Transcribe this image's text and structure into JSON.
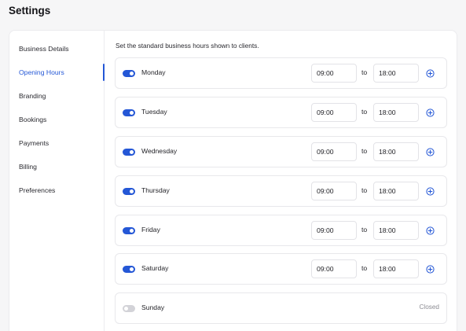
{
  "page": {
    "title": "Settings"
  },
  "sidebar": {
    "items": [
      {
        "label": "Business Details",
        "active": false
      },
      {
        "label": "Opening Hours",
        "active": true
      },
      {
        "label": "Branding",
        "active": false
      },
      {
        "label": "Bookings",
        "active": false
      },
      {
        "label": "Payments",
        "active": false
      },
      {
        "label": "Billing",
        "active": false
      },
      {
        "label": "Preferences",
        "active": false
      }
    ]
  },
  "hours": {
    "intro": "Set the standard business hours shown to clients.",
    "to_label": "to",
    "closed_label": "Closed",
    "days": [
      {
        "name": "Monday",
        "enabled": true,
        "start": "09:00",
        "end": "18:00"
      },
      {
        "name": "Tuesday",
        "enabled": true,
        "start": "09:00",
        "end": "18:00"
      },
      {
        "name": "Wednesday",
        "enabled": true,
        "start": "09:00",
        "end": "18:00"
      },
      {
        "name": "Thursday",
        "enabled": true,
        "start": "09:00",
        "end": "18:00"
      },
      {
        "name": "Friday",
        "enabled": true,
        "start": "09:00",
        "end": "18:00"
      },
      {
        "name": "Saturday",
        "enabled": true,
        "start": "09:00",
        "end": "18:00"
      },
      {
        "name": "Sunday",
        "enabled": false,
        "start": "",
        "end": ""
      }
    ]
  },
  "colors": {
    "accent": "#2457d6",
    "toggle_off": "#d3d3d8",
    "muted_text": "#8c8c93"
  }
}
